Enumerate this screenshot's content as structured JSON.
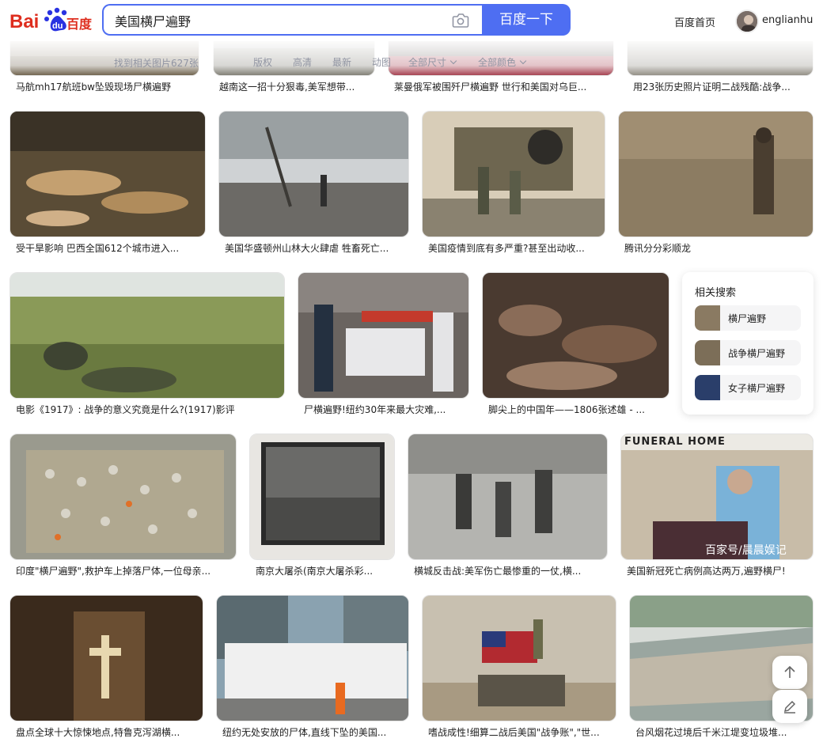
{
  "header": {
    "logo_text": "Bai du 百度",
    "search_value": "美国横尸遍野",
    "search_button": "百度一下",
    "home_link": "百度首页",
    "username": "englianhu"
  },
  "filters": {
    "result_count": "找到相关图片627张",
    "items": [
      "版权",
      "高清",
      "最新",
      "动图",
      "全部尺寸",
      "全部颜色"
    ]
  },
  "rows": [
    {
      "captions": [
        "马航mh17航班bw坠毁现场尸横遍野",
        "越南这一招十分狠毒,美军想带...",
        "莱曼俄军被围歼尸横遍野 世行和美国对乌巨...",
        "用23张历史照片证明二战残酷:战争..."
      ]
    },
    {
      "captions": [
        "受干旱影响 巴西全国612个城市进入...",
        "美国华盛顿州山林大火肆虐 牲畜死亡...",
        "美国疫情到底有多严重?甚至出动收...",
        "腾讯分分彩顺龙"
      ]
    },
    {
      "captions": [
        "电影《1917》: 战争的意义究竟是什么?(1917)影评",
        "尸横遍野!纽约30年来最大灾难,...",
        "脚尖上的中国年——1806张述雄 - ..."
      ]
    },
    {
      "captions": [
        "印度\"横尸遍野\",救护车上掉落尸体,一位母亲...",
        "南京大屠杀(南京大屠杀彩...",
        "横城反击战:美军伤亡最惨重的一仗,横...",
        "美国新冠死亡病例高达两万,遍野横尸!"
      ]
    },
    {
      "captions": [
        "盘点全球十大惊悚地点,特鲁克泻湖横...",
        "纽约无处安放的尸体,直线下坠的美国...",
        "嗜战成性!细算二战后美国\"战争账\",\"世...",
        "台风烟花过境后千米江堤变垃圾堆..."
      ]
    }
  ],
  "watermarks": [
    "百家号/晨晨娱记"
  ],
  "related": {
    "title": "相关搜索",
    "items": [
      {
        "label": "横尸遍野"
      },
      {
        "label": "战争横尸遍野"
      },
      {
        "label": "女子横尸遍野"
      }
    ]
  },
  "icons": {
    "camera": "camera-icon",
    "back_to_top": "arrow-up-icon",
    "feedback": "pencil-icon"
  },
  "colors": {
    "brand_blue": "#4e6ef2",
    "logo_red": "#de2d1e",
    "muted_text": "#9195a3"
  }
}
